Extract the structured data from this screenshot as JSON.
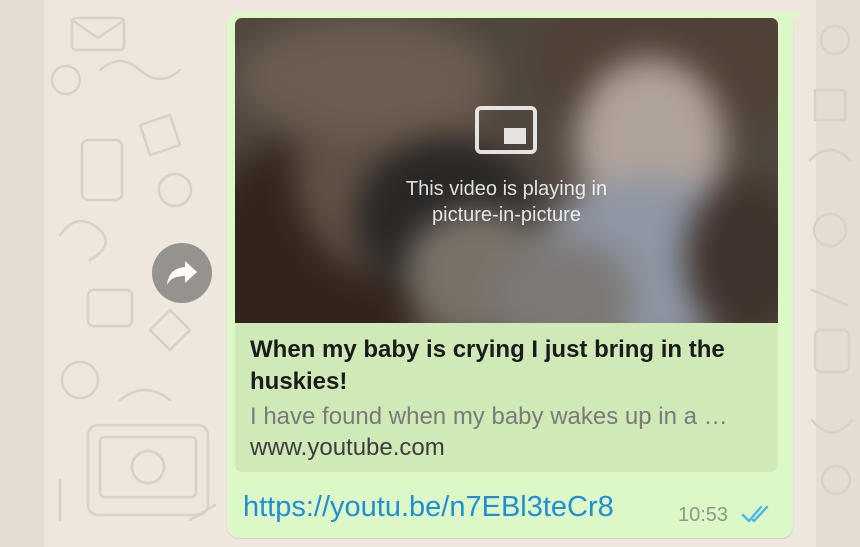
{
  "video": {
    "pip_message_line1": "This video is playing in",
    "pip_message_line2": "picture-in-picture"
  },
  "preview": {
    "title": "When my baby is crying I just bring in the huskies!",
    "description": "I have found when my baby wakes up in a …",
    "domain": "www.youtube.com"
  },
  "message": {
    "link_text": "https://youtu.be/n7EBl3teCr8",
    "time": "10:53",
    "status_icon": "double-check-read-icon"
  },
  "forward": {
    "icon": "forward-arrow-icon"
  },
  "colors": {
    "bubble_bg": "#dcf8c6",
    "preview_bg": "#cfeab7",
    "link": "#1f8ed6",
    "read_ticks": "#4fb6ec",
    "wallpaper": "#eee7de"
  }
}
